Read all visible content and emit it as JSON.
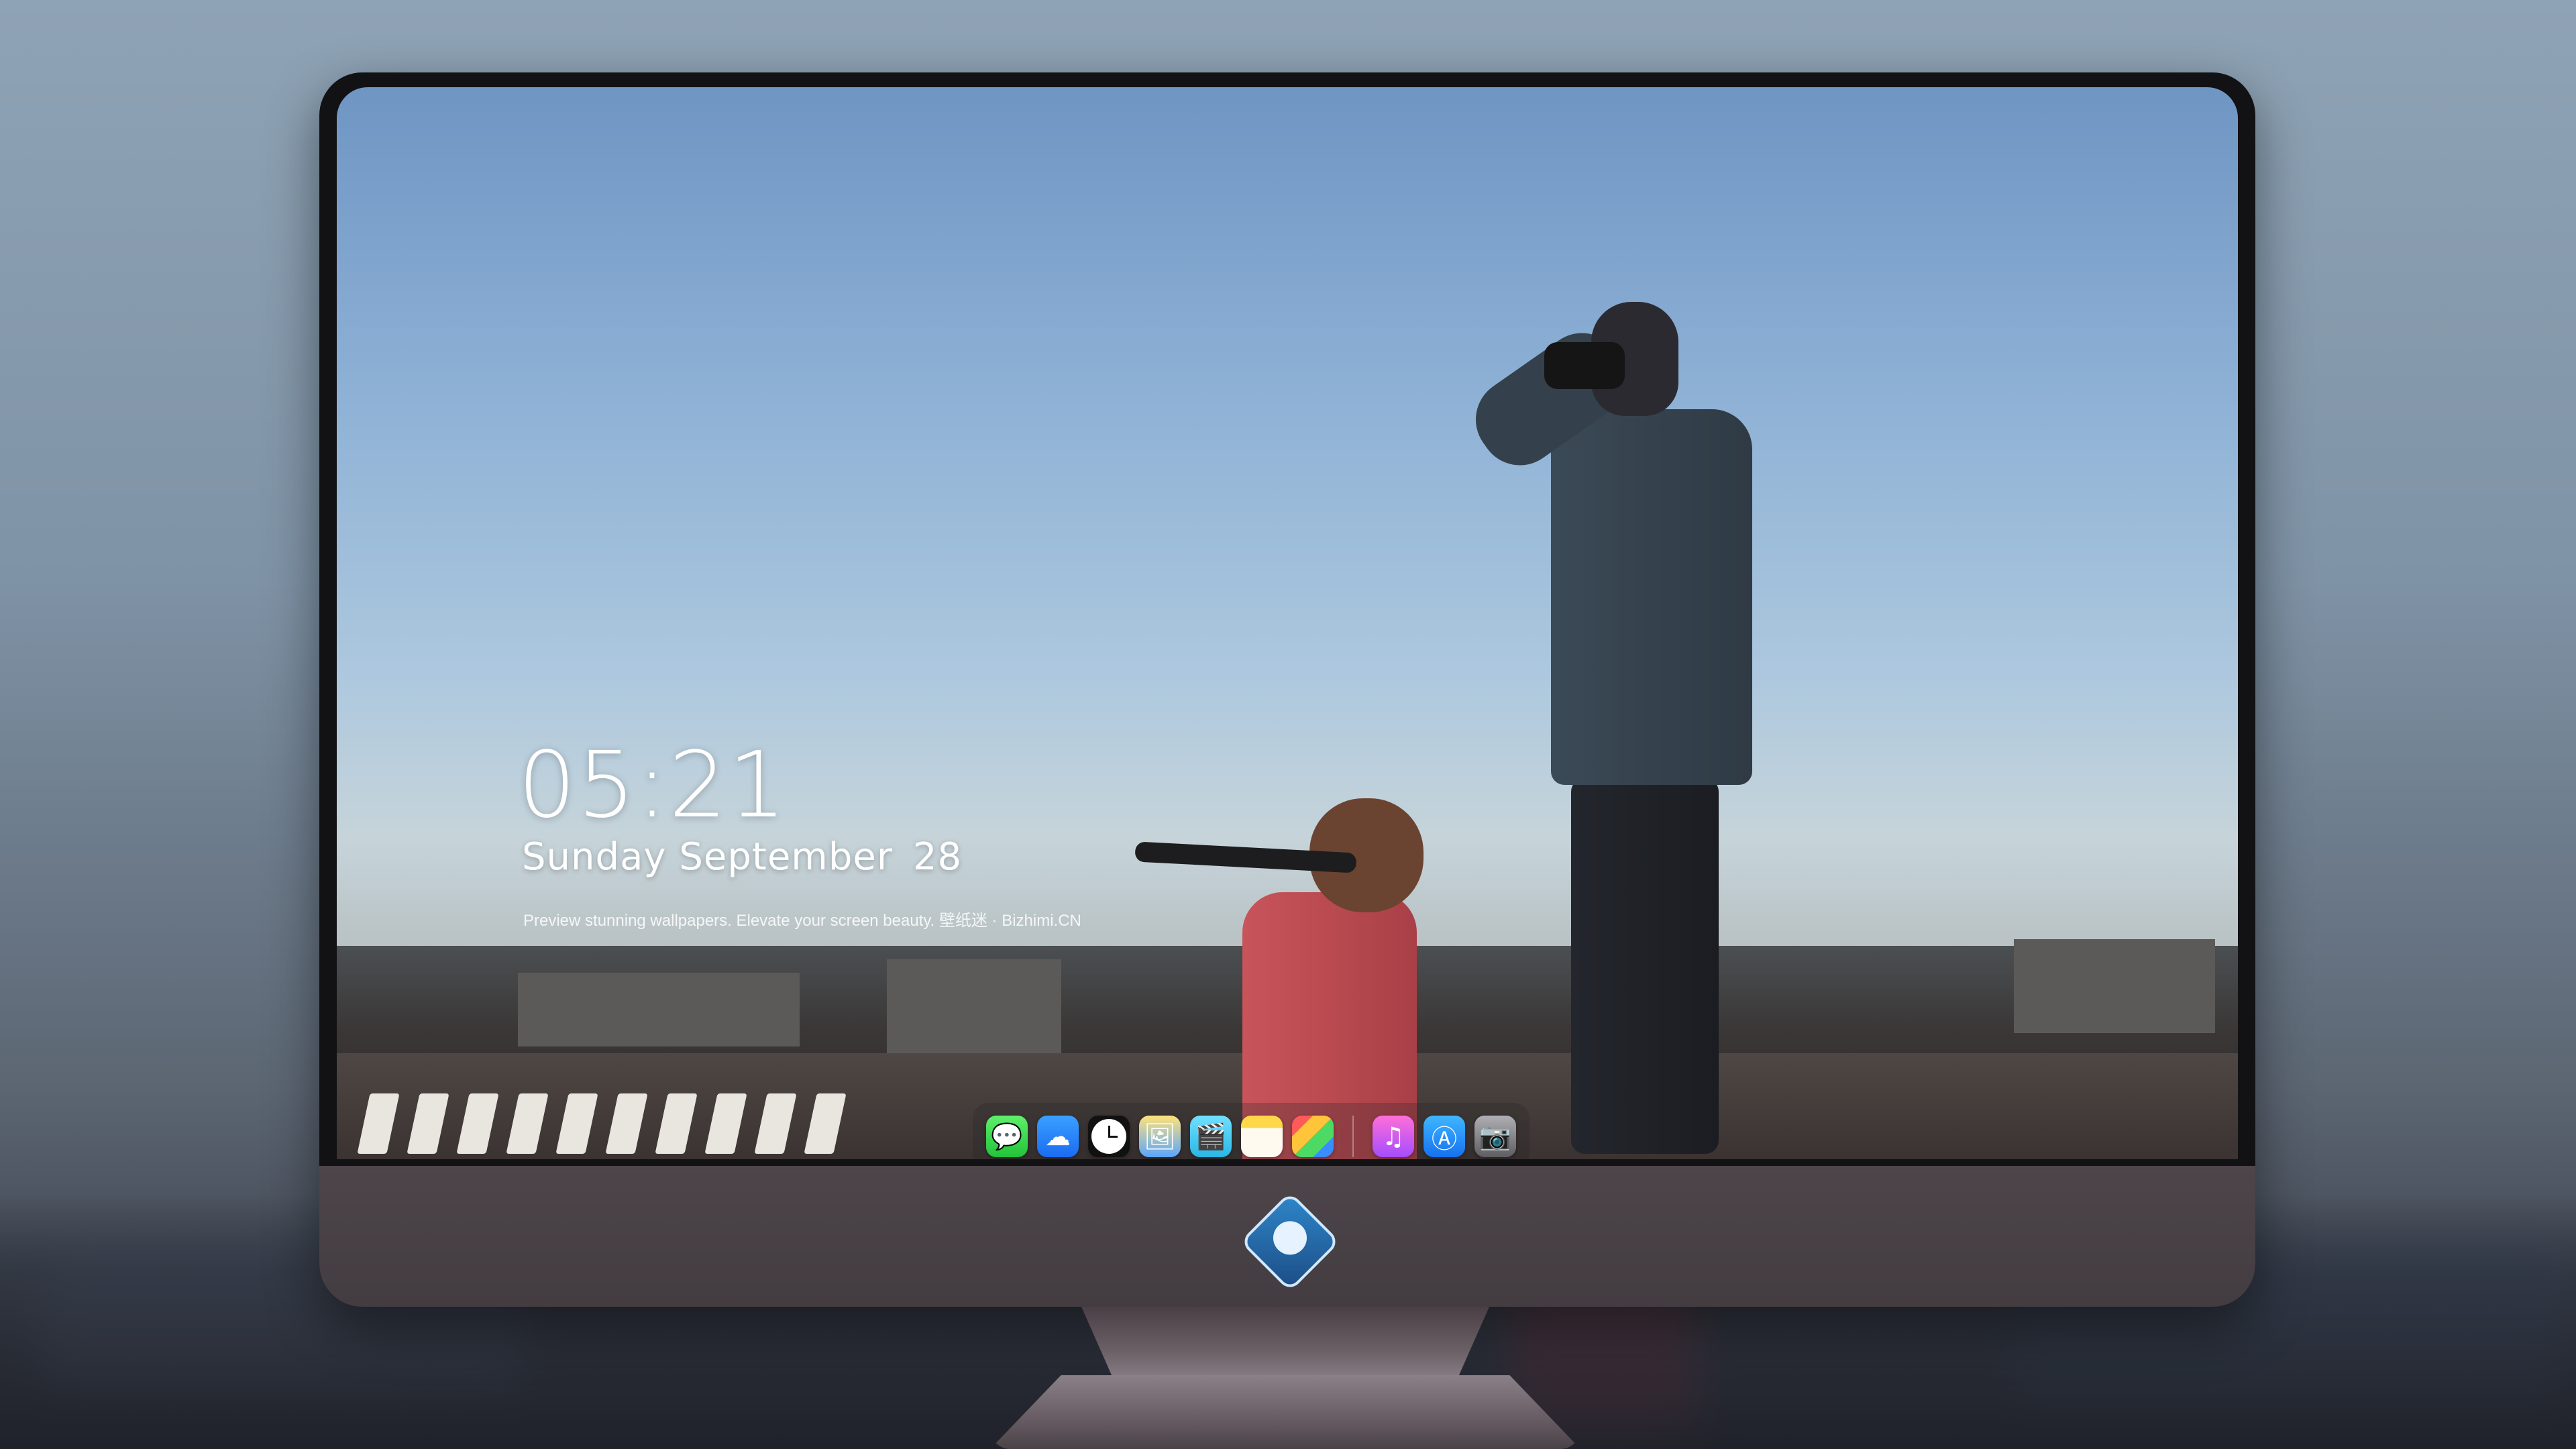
{
  "lockscreen": {
    "time": "05:21",
    "date_text": "Sunday September",
    "day_number": "28",
    "caption": "Preview stunning wallpapers. Elevate your screen beauty. 壁纸迷 · Bizhimi.CN"
  },
  "dock": {
    "icons": [
      {
        "name": "messages-icon"
      },
      {
        "name": "weather-icon"
      },
      {
        "name": "clock-icon"
      },
      {
        "name": "preview-icon"
      },
      {
        "name": "clapperboard-icon"
      },
      {
        "name": "notes-icon"
      },
      {
        "name": "photos-icon"
      },
      {
        "name": "music-icon"
      },
      {
        "name": "app-store-icon"
      },
      {
        "name": "camera-icon"
      }
    ],
    "symbols": {
      "messages": "💬",
      "weather": "☁",
      "preview": "🖼",
      "clapper": "🎬",
      "music": "♫",
      "store": "Ⓐ",
      "camera": "📷"
    }
  },
  "colors": {
    "sky_top": "#6f95c3",
    "sky_horizon": "#c6d4da",
    "monitor_bezel": "#121214",
    "monitor_chin": "#4d4549"
  }
}
